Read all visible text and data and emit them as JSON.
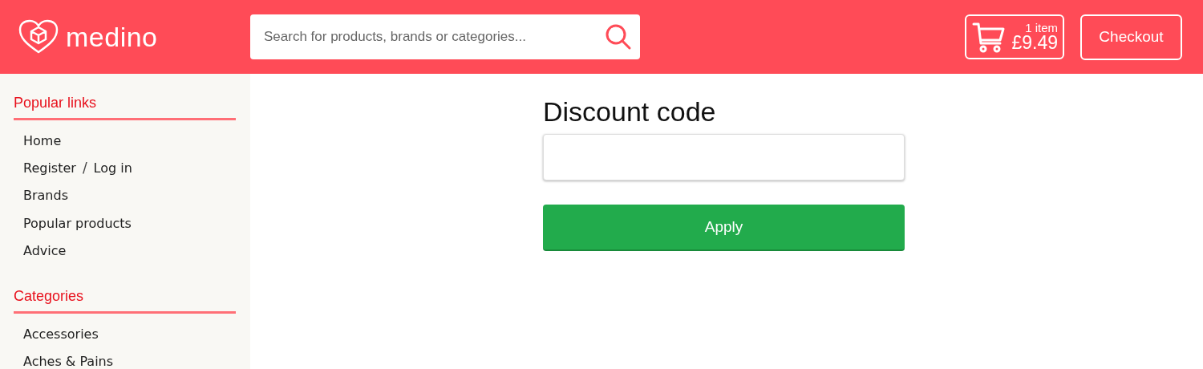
{
  "header": {
    "logo": "medino",
    "search": {
      "placeholder": "Search for products, brands or categories..."
    },
    "cart": {
      "count": "1 item",
      "total": "£9.49"
    },
    "checkout": "Checkout"
  },
  "sidebar": {
    "sections": [
      {
        "title": "Popular links",
        "items": [
          {
            "kind": "link",
            "label": "Home"
          },
          {
            "kind": "pair",
            "links": [
              "Register",
              "Log in"
            ],
            "separator": "/"
          },
          {
            "kind": "link",
            "label": "Brands"
          },
          {
            "kind": "link",
            "label": "Popular products"
          },
          {
            "kind": "link",
            "label": "Advice"
          }
        ]
      },
      {
        "title": "Categories",
        "items": [
          {
            "kind": "link",
            "label": "Accessories"
          },
          {
            "kind": "link",
            "label": "Aches & Pains"
          }
        ]
      }
    ]
  },
  "discount": {
    "title": "Discount code",
    "button": "Apply"
  }
}
